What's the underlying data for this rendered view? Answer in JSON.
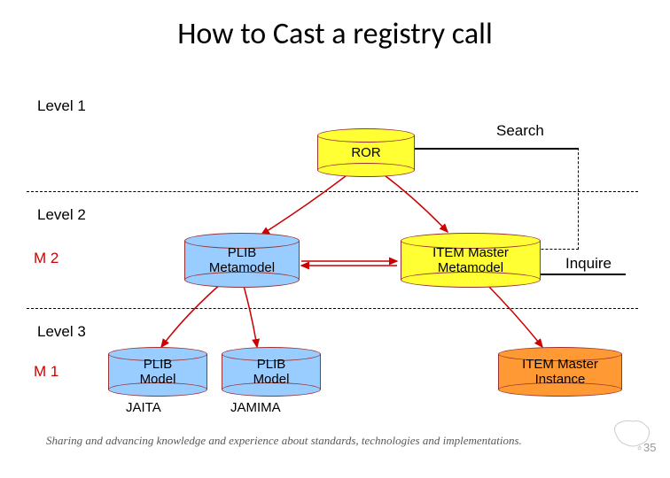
{
  "title": "How to Cast a registry call",
  "levels": {
    "l1": "Level 1",
    "l2": "Level 2",
    "l3": "Level 3"
  },
  "m_labels": {
    "m2": "M 2",
    "m1": "M 1"
  },
  "actions": {
    "search": "Search",
    "inquire": "Inquire"
  },
  "nodes": {
    "ror": "ROR",
    "plib_meta": "PLIB\nMetamodel",
    "item_meta": "ITEM  Master\nMetamodel",
    "plib_model_1": "PLIB\nModel",
    "plib_model_2": "PLIB\nModel",
    "item_instance": "ITEM Master\nInstance"
  },
  "instances": {
    "jaita": "JAITA",
    "jamima": "JAMIMA"
  },
  "footer": "Sharing and advancing knowledge and experience about standards, technologies and implementations.",
  "pagenum": "35"
}
